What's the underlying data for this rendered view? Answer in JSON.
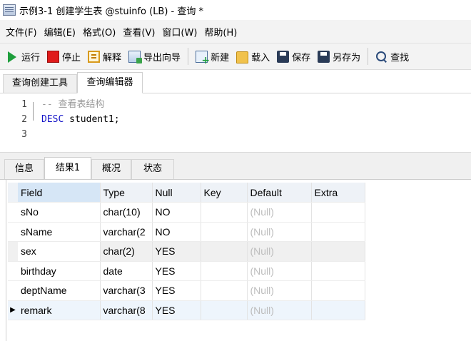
{
  "window": {
    "title": "示例3-1  创建学生表 @stuinfo (LB) - 查询 *"
  },
  "menu": [
    "文件(F)",
    "编辑(E)",
    "格式(O)",
    "查看(V)",
    "窗口(W)",
    "帮助(H)"
  ],
  "toolbar": {
    "run": "运行",
    "stop": "停止",
    "explain": "解释",
    "export_wizard": "导出向导",
    "new": "新建",
    "load": "载入",
    "save": "保存",
    "save_as": "另存为",
    "find": "查找"
  },
  "tabs": [
    "查询创建工具",
    "查询编辑器"
  ],
  "active_tab": "查询编辑器",
  "editor": {
    "line_numbers": [
      "1",
      "2",
      "3"
    ],
    "comment": "-- 查看表结构",
    "keyword": "DESC",
    "statement_rest": " student1;"
  },
  "result_tabs": [
    "信息",
    "结果1",
    "概况",
    "状态"
  ],
  "active_result_tab": "结果1",
  "grid": {
    "columns": [
      "Field",
      "Type",
      "Null",
      "Key",
      "Default",
      "Extra"
    ],
    "rows": [
      {
        "field": "sNo",
        "type": "char(10)",
        "null": "NO",
        "key": "",
        "default": "(Null)",
        "extra": ""
      },
      {
        "field": "sName",
        "type": "varchar(2",
        "null": "NO",
        "key": "",
        "default": "(Null)",
        "extra": ""
      },
      {
        "field": "sex",
        "type": "char(2)",
        "null": "YES",
        "key": "",
        "default": "(Null)",
        "extra": ""
      },
      {
        "field": "birthday",
        "type": "date",
        "null": "YES",
        "key": "",
        "default": "(Null)",
        "extra": ""
      },
      {
        "field": "deptName",
        "type": "varchar(3",
        "null": "YES",
        "key": "",
        "default": "(Null)",
        "extra": ""
      },
      {
        "field": "remark",
        "type": "varchar(8",
        "null": "YES",
        "key": "",
        "default": "(Null)",
        "extra": ""
      }
    ],
    "selected_row_indicator": "▶"
  }
}
